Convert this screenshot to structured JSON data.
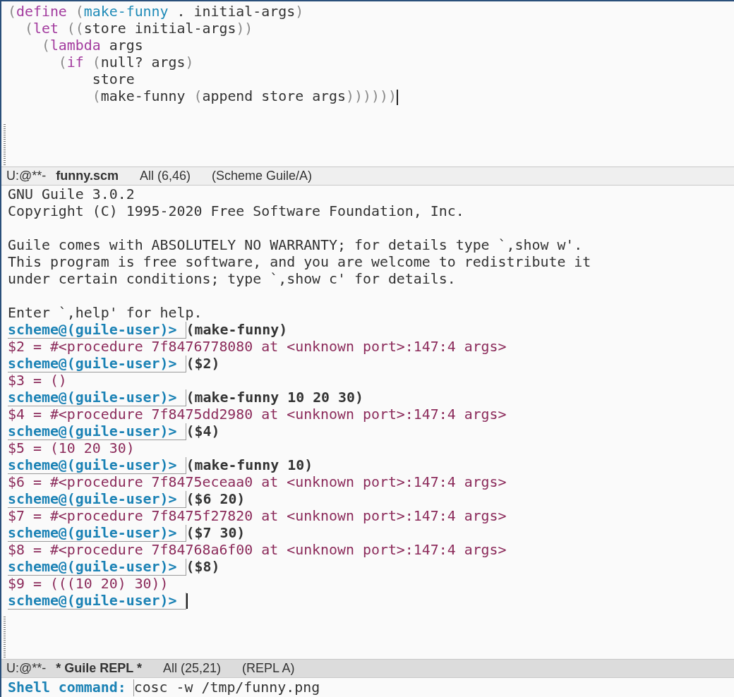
{
  "code_window": {
    "lines": [
      {
        "tokens": [
          {
            "kind": "paren",
            "text": "("
          },
          {
            "kind": "keyword",
            "text": "define"
          },
          {
            "kind": "paren",
            "text": " ("
          },
          {
            "kind": "function",
            "text": "make-funny"
          },
          {
            "kind": "plain",
            "text": " . initial-args"
          },
          {
            "kind": "paren",
            "text": ")"
          }
        ]
      },
      {
        "tokens": [
          {
            "kind": "paren",
            "text": "  ("
          },
          {
            "kind": "keyword",
            "text": "let"
          },
          {
            "kind": "paren",
            "text": " (("
          },
          {
            "kind": "plain",
            "text": "store initial-args"
          },
          {
            "kind": "paren",
            "text": "))"
          }
        ]
      },
      {
        "tokens": [
          {
            "kind": "paren",
            "text": "    ("
          },
          {
            "kind": "keyword",
            "text": "lambda"
          },
          {
            "kind": "plain",
            "text": " args"
          }
        ]
      },
      {
        "tokens": [
          {
            "kind": "paren",
            "text": "      ("
          },
          {
            "kind": "keyword",
            "text": "if"
          },
          {
            "kind": "paren",
            "text": " ("
          },
          {
            "kind": "plain",
            "text": "null? args"
          },
          {
            "kind": "paren",
            "text": ")"
          }
        ]
      },
      {
        "tokens": [
          {
            "kind": "plain",
            "text": "          store"
          }
        ]
      },
      {
        "tokens": [
          {
            "kind": "paren",
            "text": "          ("
          },
          {
            "kind": "plain",
            "text": "make-funny "
          },
          {
            "kind": "paren",
            "text": "("
          },
          {
            "kind": "plain",
            "text": "append store args"
          },
          {
            "kind": "paren",
            "text": "))))))"
          }
        ],
        "cursor": true
      }
    ],
    "mode_line": {
      "active": false,
      "status": "U:@**-",
      "buffer": "funny.scm",
      "position": "All (6,46)",
      "mode": "(Scheme Guile/A)"
    }
  },
  "repl_window": {
    "lines": [
      {
        "kind": "output",
        "text": "GNU Guile 3.0.2"
      },
      {
        "kind": "output",
        "text": "Copyright (C) 1995-2020 Free Software Foundation, Inc."
      },
      {
        "kind": "blank"
      },
      {
        "kind": "output",
        "text": "Guile comes with ABSOLUTELY NO WARRANTY; for details type `,show w'."
      },
      {
        "kind": "output",
        "text": "This program is free software, and you are welcome to redistribute it"
      },
      {
        "kind": "output",
        "text": "under certain conditions; type `,show c' for details."
      },
      {
        "kind": "blank"
      },
      {
        "kind": "output",
        "text": "Enter `,help' for help."
      },
      {
        "kind": "prompt",
        "prompt": "scheme@(guile-user)>",
        "input": "(make-funny)",
        "cursor": false
      },
      {
        "kind": "result",
        "text": "$2 = #<procedure 7f8476778080 at <unknown port>:147:4 args>"
      },
      {
        "kind": "prompt",
        "prompt": "scheme@(guile-user)>",
        "input": "($2)",
        "cursor": false
      },
      {
        "kind": "result",
        "text": "$3 = ()"
      },
      {
        "kind": "prompt",
        "prompt": "scheme@(guile-user)>",
        "input": "(make-funny 10 20 30)",
        "cursor": false
      },
      {
        "kind": "result",
        "text": "$4 = #<procedure 7f8475dd2980 at <unknown port>:147:4 args>"
      },
      {
        "kind": "prompt",
        "prompt": "scheme@(guile-user)>",
        "input": "($4)",
        "cursor": false
      },
      {
        "kind": "result",
        "text": "$5 = (10 20 30)"
      },
      {
        "kind": "prompt",
        "prompt": "scheme@(guile-user)>",
        "input": "(make-funny 10)",
        "cursor": false
      },
      {
        "kind": "result",
        "text": "$6 = #<procedure 7f8475eceaa0 at <unknown port>:147:4 args>"
      },
      {
        "kind": "prompt",
        "prompt": "scheme@(guile-user)>",
        "input": "($6 20)",
        "cursor": false
      },
      {
        "kind": "result",
        "text": "$7 = #<procedure 7f8475f27820 at <unknown port>:147:4 args>"
      },
      {
        "kind": "prompt",
        "prompt": "scheme@(guile-user)>",
        "input": "($7 30)",
        "cursor": false
      },
      {
        "kind": "result",
        "text": "$8 = #<procedure 7f84768a6f00 at <unknown port>:147:4 args>"
      },
      {
        "kind": "prompt",
        "prompt": "scheme@(guile-user)>",
        "input": "($8)",
        "cursor": false
      },
      {
        "kind": "result",
        "text": "$9 = (((10 20) 30))"
      },
      {
        "kind": "prompt",
        "prompt": "scheme@(guile-user)>",
        "cursor": true
      }
    ],
    "mode_line": {
      "active": true,
      "status": "U:@**-",
      "buffer": "* Guile REPL *",
      "position": "All (25,21)",
      "mode": "(REPL A)"
    }
  },
  "minibuffer": {
    "prompt": "Shell command:",
    "value": "cosc -w /tmp/funny.png"
  }
}
